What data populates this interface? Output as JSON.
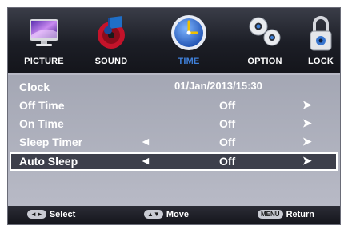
{
  "tabs": [
    {
      "label": "PICTURE",
      "icon": "monitor-icon"
    },
    {
      "label": "SOUND",
      "icon": "speaker-disc-icon"
    },
    {
      "label": "TIME",
      "icon": "clock-icon",
      "active": true
    },
    {
      "label": "OPTION",
      "icon": "gears-icon"
    },
    {
      "label": "LOCK",
      "icon": "padlock-icon"
    }
  ],
  "clock": {
    "label": "Clock",
    "value": "01/Jan/2013/15:30"
  },
  "rows": [
    {
      "label": "Off Time",
      "value": "Off",
      "right": "➤"
    },
    {
      "label": "On Time",
      "value": "Off",
      "right": "➤"
    },
    {
      "label": "Sleep Timer",
      "left": "◄",
      "value": "Off",
      "right": "➤"
    },
    {
      "label": "Auto Sleep",
      "left": "◄",
      "value": "Off",
      "right": "➤"
    }
  ],
  "footer": {
    "select": {
      "key": "◄►",
      "label": "Select"
    },
    "move": {
      "key": "▲▼",
      "label": "Move"
    },
    "return": {
      "key": "MENU",
      "label": "Return"
    }
  },
  "colors": {
    "active_tab": "#3f7fd8",
    "panel": "#b7b9c5",
    "selected_row": "#3d3f4b"
  }
}
